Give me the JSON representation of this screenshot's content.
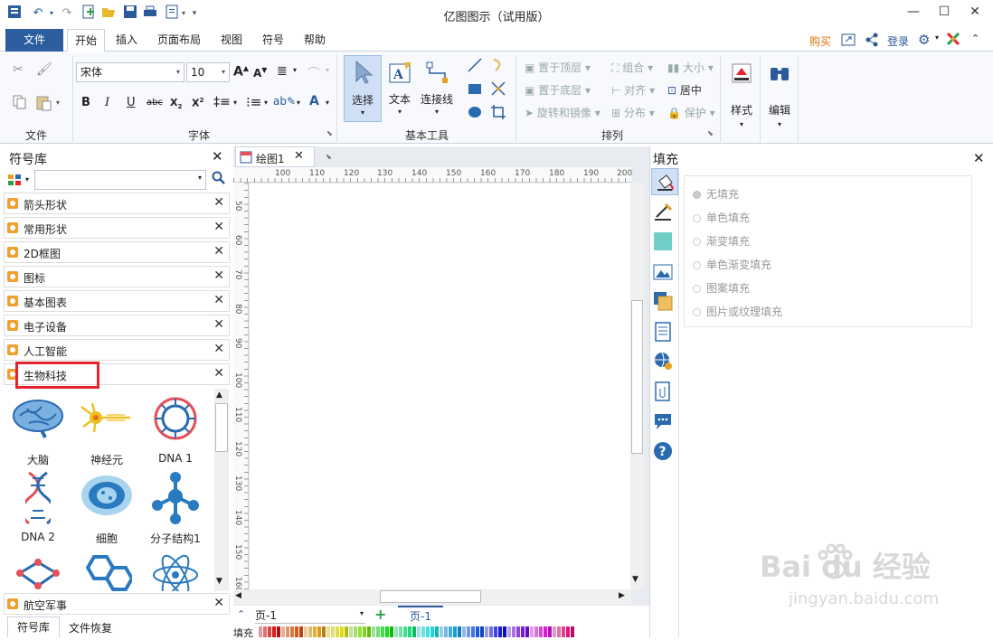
{
  "app_title": "亿图图示（试用版）",
  "quick_access": [
    "undo",
    "redo",
    "new",
    "open",
    "save",
    "print",
    "export"
  ],
  "window_controls": {
    "minimize": "—",
    "maximize": "☐",
    "close": "✕"
  },
  "tabs": [
    {
      "label": "文件"
    },
    {
      "label": "开始"
    },
    {
      "label": "插入"
    },
    {
      "label": "页面布局"
    },
    {
      "label": "视图"
    },
    {
      "label": "符号"
    },
    {
      "label": "帮助"
    }
  ],
  "right_links": {
    "buy": "购买",
    "login": "登录"
  },
  "ribbon": {
    "file_group": "文件",
    "font_group": "字体",
    "font_name": "宋体",
    "font_size": "10",
    "basic_tools_group": "基本工具",
    "select": "选择",
    "text": "文本",
    "connector": "连接线",
    "arrange_group": "排列",
    "bring_top": "置于顶层",
    "send_bottom": "置于底层",
    "rotate_mirror": "旋转和镜像",
    "group": "组合",
    "align": "对齐",
    "distribute": "分布",
    "size": "大小",
    "center": "居中",
    "protect": "保护",
    "style": "样式",
    "edit": "编辑"
  },
  "library": {
    "title": "符号库",
    "search_placeholder": "",
    "categories": [
      "箭头形状",
      "常用形状",
      "2D框图",
      "图标",
      "基本图表",
      "电子设备",
      "人工智能",
      "生物科技"
    ],
    "shapes": [
      {
        "label": "大脑",
        "icon": "brain-icon"
      },
      {
        "label": "神经元",
        "icon": "neuron-icon"
      },
      {
        "label": "DNA 1",
        "icon": "dna-ring-icon"
      },
      {
        "label": "DNA 2",
        "icon": "dna-helix-icon"
      },
      {
        "label": "细胞",
        "icon": "cell-icon"
      },
      {
        "label": "分子结构1",
        "icon": "molecule-icon"
      }
    ],
    "bottom_category": "航空军事",
    "bottom_tabs": [
      "符号库",
      "文件恢复"
    ]
  },
  "document": {
    "tab": "绘图1",
    "ruler_h": [
      "100",
      "110",
      "120",
      "130",
      "140",
      "150",
      "160",
      "170",
      "180",
      "190",
      "200"
    ],
    "ruler_v": [
      "50",
      "60",
      "70",
      "80",
      "90",
      "100",
      "110",
      "120",
      "130",
      "140",
      "150",
      "160"
    ],
    "page_select": "页-1",
    "page_tab": "页-1",
    "fill_label": "填充"
  },
  "fill_panel": {
    "title": "填充",
    "options": [
      "无填充",
      "单色填充",
      "渐变填充",
      "单色渐变填充",
      "图案填充",
      "图片或纹理填充"
    ]
  },
  "watermark": {
    "text": "Bai du 经验",
    "url": "jingyan.baidu.com"
  },
  "colors": {
    "file_tab": "#2c5d9e",
    "accent": "#2a5a9a",
    "highlight": "#e5252b"
  }
}
